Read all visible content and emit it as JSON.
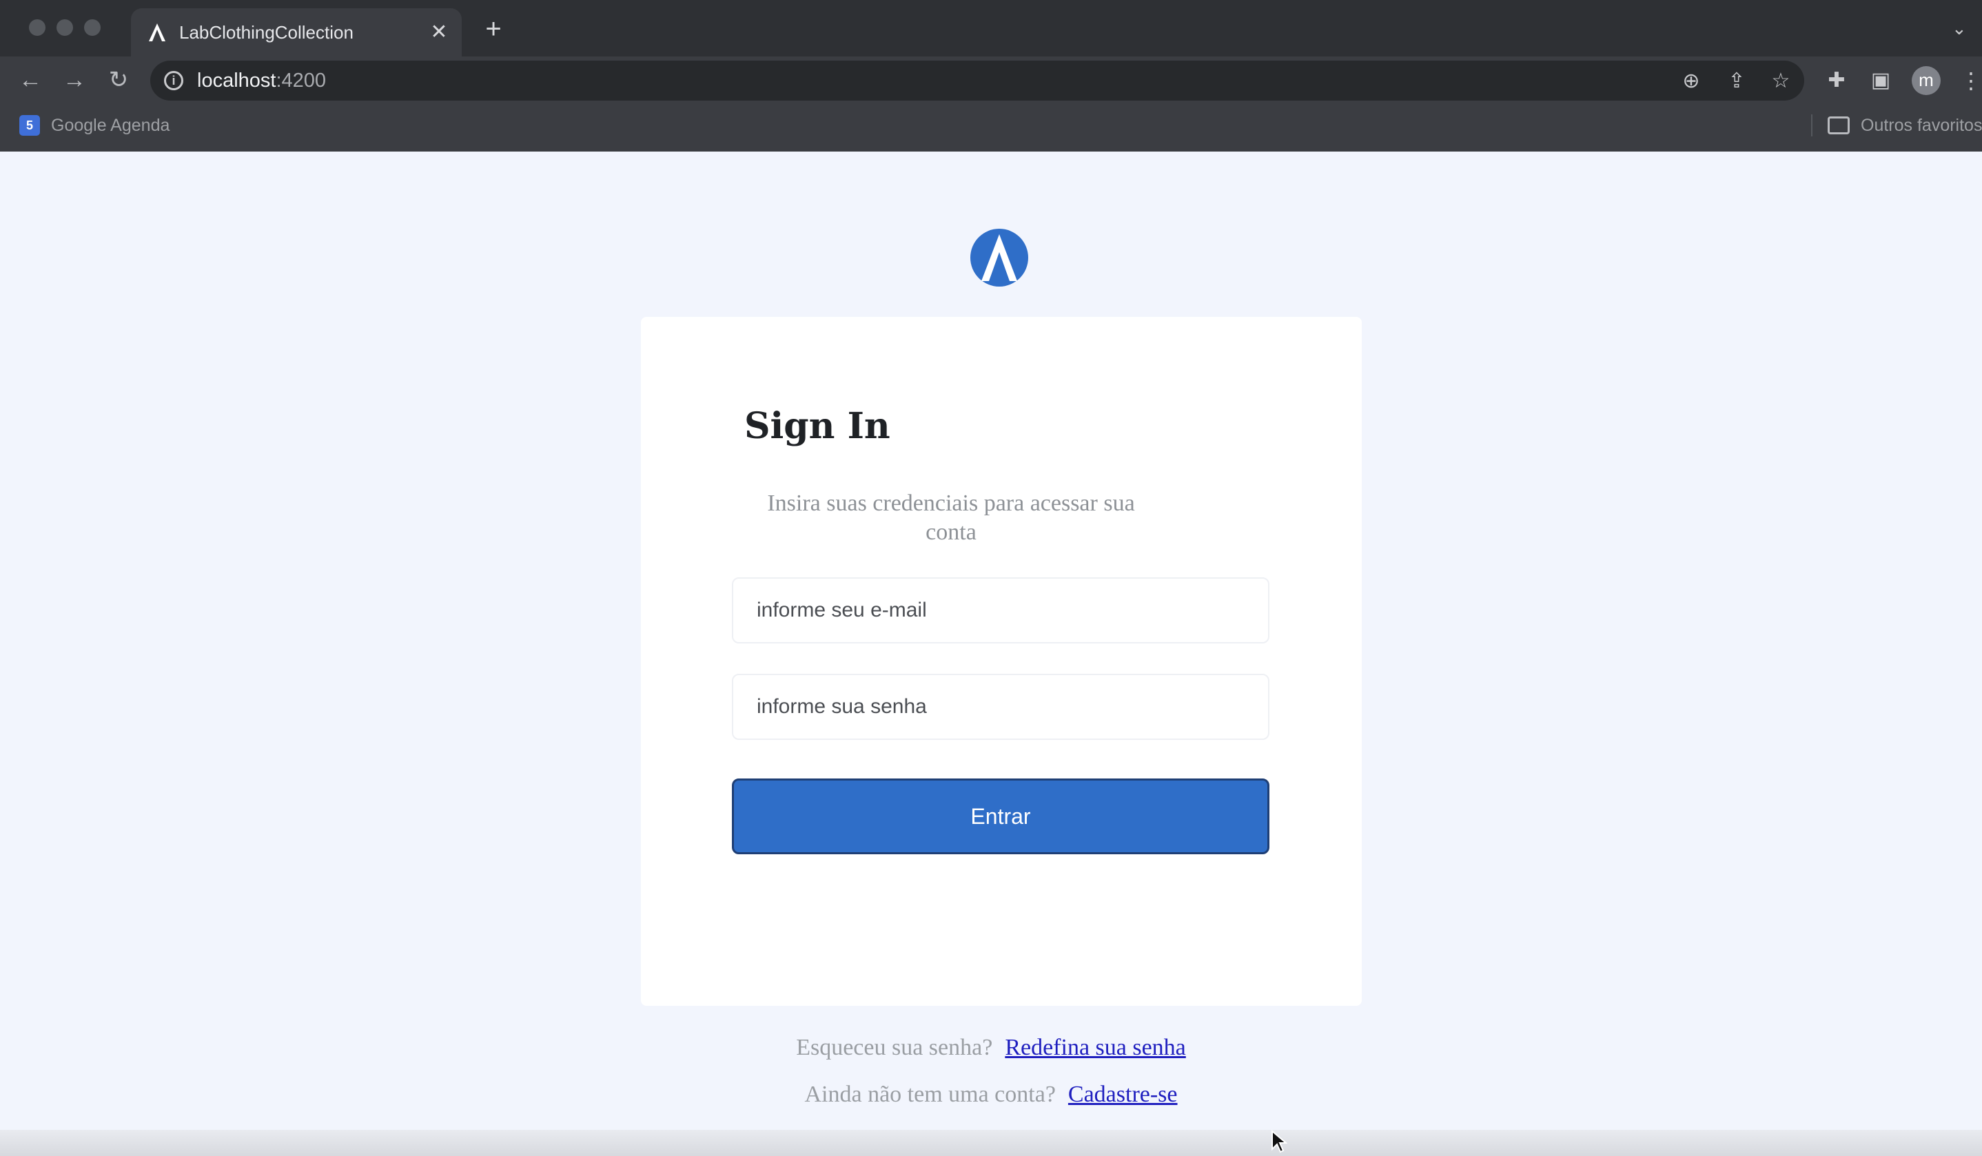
{
  "browser": {
    "tab": {
      "title": "LabClothingCollection",
      "favicon_letter": "A",
      "close_glyph": "✕"
    },
    "new_tab_glyph": "+",
    "address": {
      "host": "localhost",
      "port": ":4200"
    },
    "profile_initial": "m",
    "bookmarks": [
      {
        "label": "Google Agenda",
        "icon_text": "5"
      }
    ],
    "other_bookmarks_label": "Outros favoritos",
    "icons": [
      "back-icon",
      "forward-icon",
      "reload-icon",
      "info-icon",
      "zoom-icon",
      "share-icon",
      "star-icon",
      "extensions-icon",
      "side-panel-icon",
      "menu-icon"
    ]
  },
  "login": {
    "title": "Sign In",
    "subtitle": "Insira suas credenciais para acessar sua conta",
    "email_placeholder": "informe seu e-mail",
    "password_placeholder": "informe sua senha",
    "submit_label": "Entrar"
  },
  "links": {
    "forgot_prompt": "Esqueceu sua senha?",
    "forgot_link": "Redefina sua senha",
    "signup_prompt": "Ainda não tem uma conta?",
    "signup_link": "Cadastre-se"
  },
  "colors": {
    "accent": "#2f6ec8",
    "page_background": "#f2f5fd",
    "link": "#1f1fbf"
  }
}
